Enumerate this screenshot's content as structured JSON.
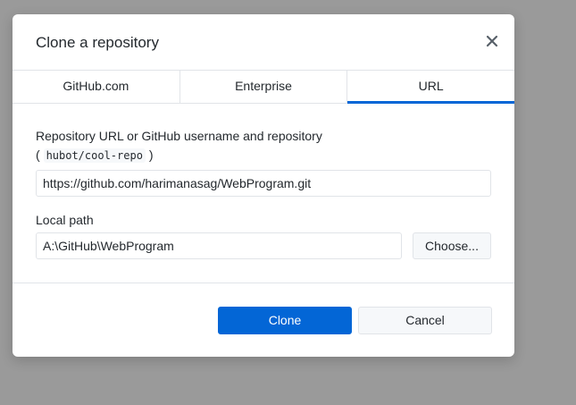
{
  "dialog": {
    "title": "Clone a repository"
  },
  "tabs": [
    {
      "label": "GitHub.com",
      "active": false
    },
    {
      "label": "Enterprise",
      "active": false
    },
    {
      "label": "URL",
      "active": true
    }
  ],
  "url_section": {
    "label": "Repository URL or GitHub username and repository",
    "hint_open": "( ",
    "hint_code": "hubot/cool-repo",
    "hint_close": " )",
    "value": "https://github.com/harimanasag/WebProgram.git"
  },
  "path_section": {
    "label": "Local path",
    "value": "A:\\GitHub\\WebProgram",
    "choose_label": "Choose..."
  },
  "footer": {
    "clone_label": "Clone",
    "cancel_label": "Cancel"
  },
  "colors": {
    "accent": "#0366d6",
    "backdrop": "#9a9a9a"
  },
  "icons": {
    "close": "close-icon"
  }
}
